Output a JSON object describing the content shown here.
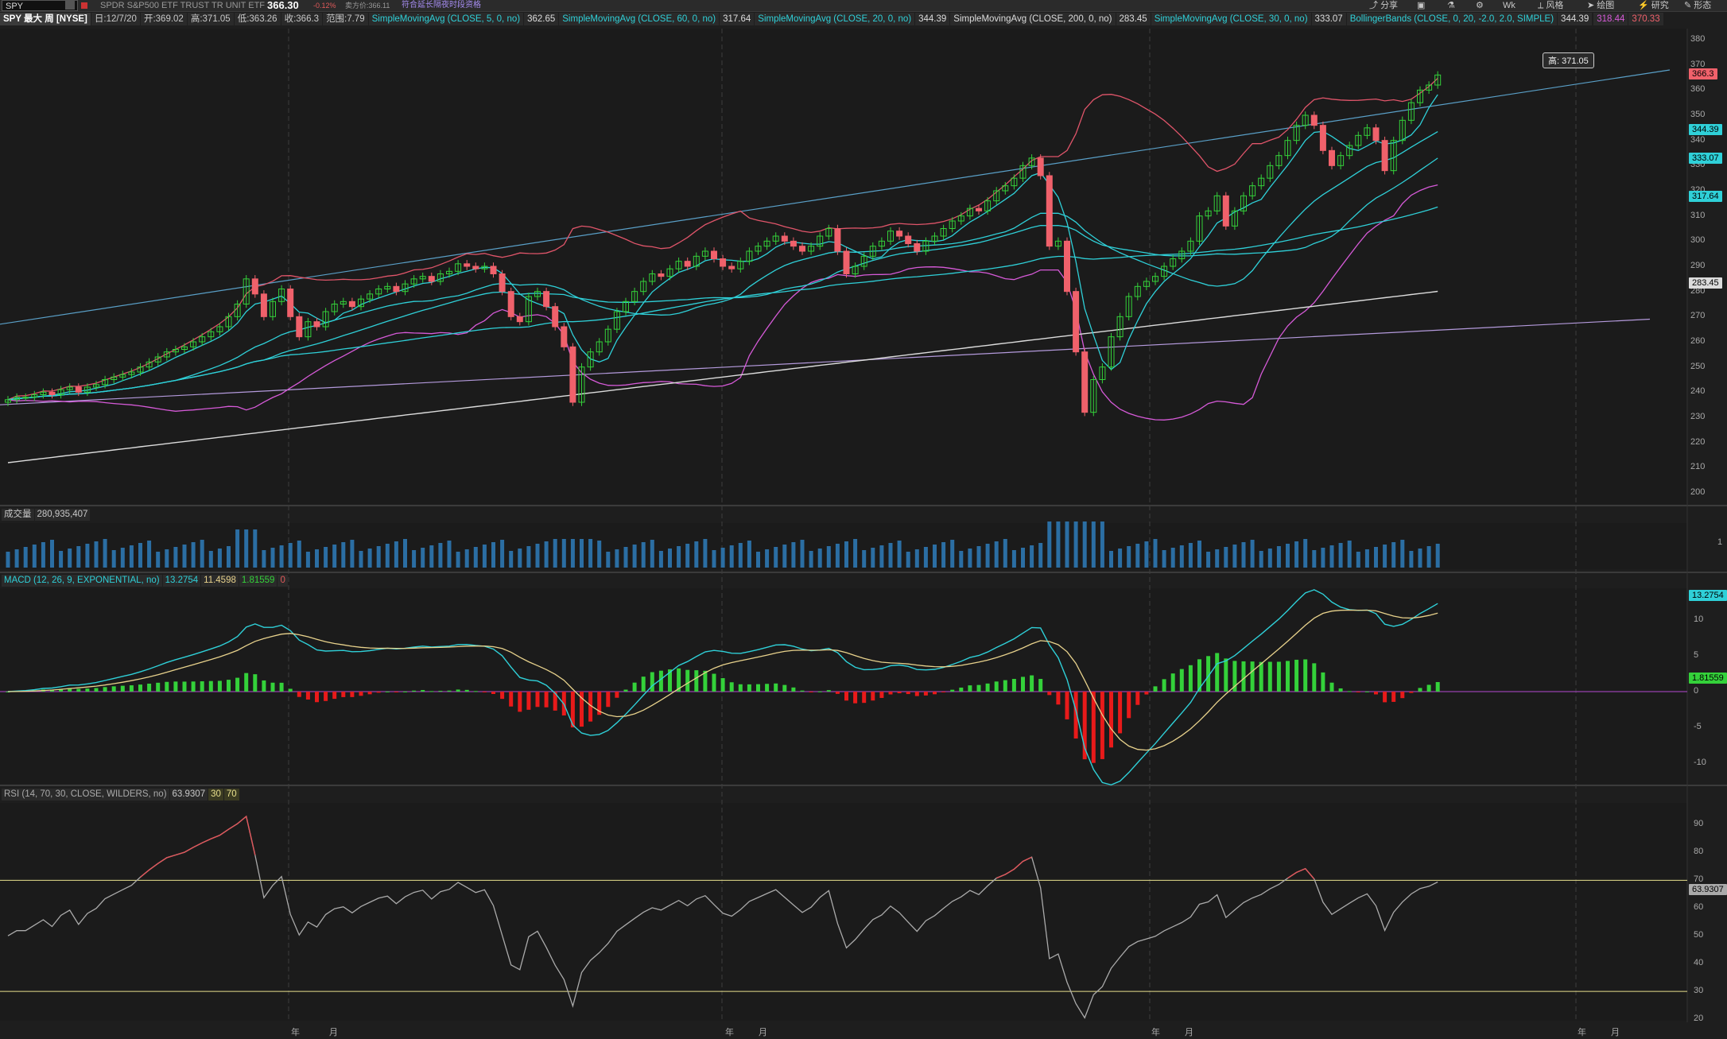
{
  "toolbar": {
    "symbol": "SPY",
    "description": "SPDR S&P500 ETF TRUST TR UNIT ETF",
    "last": "366.30",
    "change": "-0.12%",
    "bid": "卖方价:366.11",
    "promo": "符合延长隔夜时段资格",
    "share": "分享",
    "period": "Wk",
    "style": "风格",
    "draw": "绘图",
    "research": "研究",
    "shapes": "形态"
  },
  "legend": {
    "title": "SPY 最大 周 [NYSE]",
    "date": "日:12/7/20",
    "open": "开:369.02",
    "high": "高:371.05",
    "low": "低:363.26",
    "close": "收:366.3",
    "range": "范围:7.79",
    "studies": [
      {
        "label": "SimpleMovingAvg (CLOSE, 5, 0, no)",
        "value": "362.65",
        "color": "#2fd0d8"
      },
      {
        "label": "SimpleMovingAvg (CLOSE, 60, 0, no)",
        "value": "317.64",
        "color": "#2fd0d8"
      },
      {
        "label": "SimpleMovingAvg (CLOSE, 20, 0, no)",
        "value": "344.39",
        "color": "#2fd0d8"
      },
      {
        "label": "SimpleMovingAvg (CLOSE, 200, 0, no)",
        "value": "283.45",
        "color": "#dcdcdc"
      },
      {
        "label": "SimpleMovingAvg (CLOSE, 30, 0, no)",
        "value": "333.07",
        "color": "#2fd0d8"
      },
      {
        "label": "BollingerBands (CLOSE, 0, 20, -2.0, 2.0, SIMPLE)",
        "value": "344.39",
        "color": "#2fd0d8"
      }
    ],
    "bb_lower": "318.44",
    "bb_upper": "370.33"
  },
  "callout_high": "高: 371.05",
  "price_axis": {
    "ticks": [
      "380",
      "370",
      "360",
      "350",
      "340",
      "330",
      "320",
      "310",
      "300",
      "290",
      "280",
      "270",
      "260",
      "250",
      "240",
      "230",
      "220",
      "210",
      "200"
    ],
    "tags": [
      {
        "text": "366.3",
        "bg": "#f0616b"
      },
      {
        "text": "344.39",
        "bg": "#2fd0d8"
      },
      {
        "text": "333.07",
        "bg": "#2fd0d8"
      },
      {
        "text": "317.64",
        "bg": "#2fd0d8"
      },
      {
        "text": "283.45",
        "bg": "#dcdcdc"
      }
    ]
  },
  "volume": {
    "label": "成交量",
    "value": "280,935,407",
    "tick": "1"
  },
  "macd": {
    "label": "MACD (12, 26, 9, EXPONENTIAL, no)",
    "value": "13.2754",
    "avg": "11.4598",
    "diff": "1.81559",
    "ticks": [
      "10",
      "5",
      "0",
      "-5",
      "-10"
    ]
  },
  "rsi": {
    "label": "RSI (14, 70, 30, CLOSE, WILDERS, no)",
    "value": "63.9307",
    "os": "30",
    "ob": "70",
    "ticks": [
      "90",
      "80",
      "70",
      "60",
      "50",
      "40",
      "30",
      "20"
    ]
  },
  "time_axis": [
    "年",
    "月",
    "年",
    "月",
    "年",
    "月",
    "年",
    "月"
  ],
  "colors": {
    "up": "#34d13a",
    "down": "#f0616b",
    "ma": "#2fd0d8",
    "bb": "#e0556a",
    "bbl": "#d65ad8",
    "ma200": "#dcdcdc",
    "macd": "#2fd0d8",
    "signal": "#e8d28c"
  },
  "chart_data": {
    "type": "candlestick",
    "ylim": [
      200,
      380
    ],
    "closes": [
      237,
      238,
      238,
      239,
      240,
      239,
      241,
      242,
      240,
      242,
      243,
      245,
      246,
      247,
      248,
      250,
      252,
      254,
      256,
      257,
      258,
      260,
      262,
      264,
      266,
      270,
      275,
      285,
      279,
      270,
      276,
      281,
      270,
      262,
      268,
      266,
      272,
      275,
      276,
      274,
      277,
      279,
      281,
      282,
      280,
      283,
      285,
      286,
      284,
      287,
      288,
      291,
      290,
      289,
      290,
      287,
      280,
      270,
      268,
      278,
      280,
      274,
      266,
      258,
      236,
      250,
      256,
      260,
      265,
      272,
      276,
      280,
      284,
      287,
      286,
      289,
      292,
      290,
      294,
      296,
      293,
      290,
      289,
      292,
      296,
      298,
      300,
      302,
      300,
      298,
      296,
      298,
      302,
      305,
      296,
      287,
      290,
      294,
      298,
      300,
      304,
      302,
      299,
      296,
      300,
      302,
      305,
      308,
      310,
      313,
      312,
      316,
      320,
      322,
      325,
      330,
      333,
      326,
      298,
      300,
      280,
      256,
      232,
      245,
      250,
      262,
      270,
      278,
      282,
      284,
      286,
      290,
      293,
      296,
      300,
      310,
      312,
      318,
      306,
      312,
      318,
      322,
      325,
      330,
      334,
      340,
      346,
      350,
      346,
      336,
      330,
      334,
      338,
      342,
      345,
      340,
      328,
      340,
      348,
      355,
      360,
      362,
      366
    ]
  }
}
